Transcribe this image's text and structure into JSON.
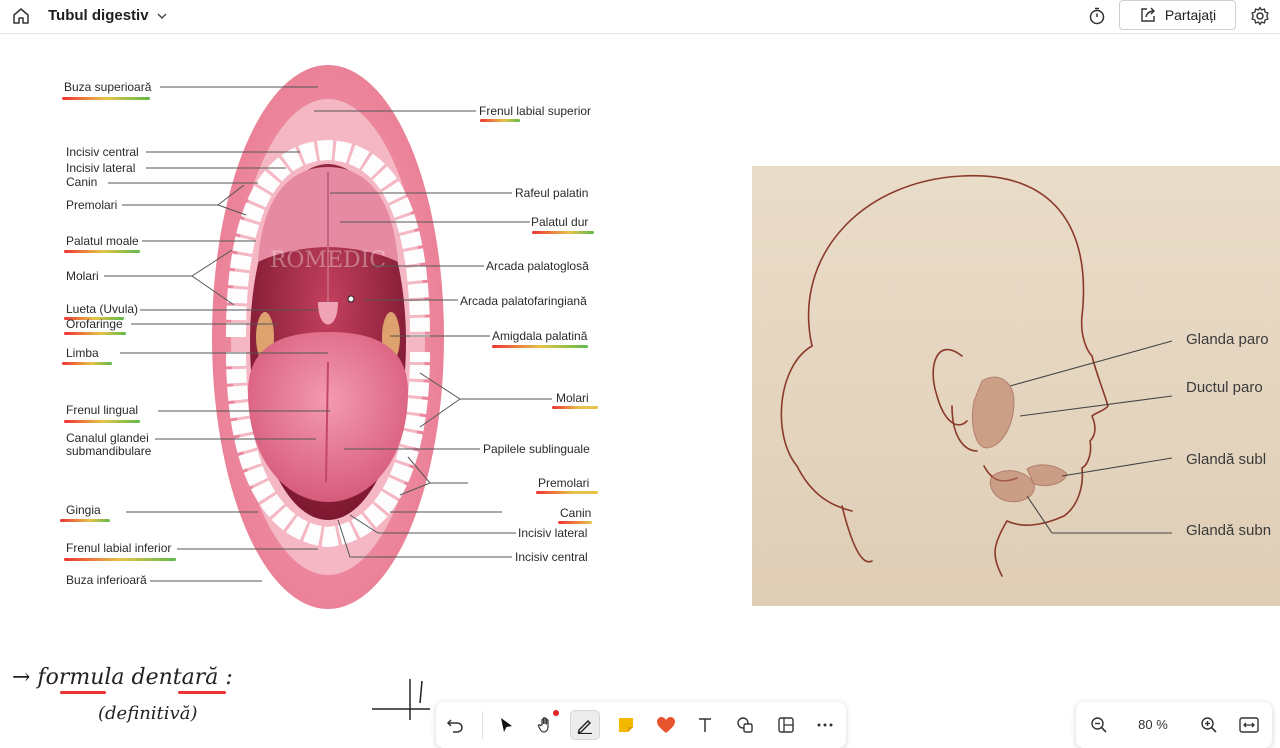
{
  "header": {
    "title": "Tubul digestiv",
    "share_label": "Partajați"
  },
  "mouth_labels_left": [
    "Buza superioară",
    "Incisiv central",
    "Incisiv lateral",
    "Canin",
    "Premolari",
    "Palatul moale",
    "Molari",
    "Lueta (Uvula)",
    "Orofaringe",
    "Limba",
    "Frenul lingual",
    "Canalul glandei",
    "submandibulare",
    "Gingia",
    "Frenul labial inferior",
    "Buza inferioară"
  ],
  "mouth_labels_right": [
    "Frenul labial superior",
    "Rafeul palatin",
    "Palatul dur",
    "Arcada palatoglosă",
    "Arcada palatofaringiană",
    "Amigdala palatină",
    "Molari",
    "Papilele sublinguale",
    "Premolari",
    "Canin",
    "Incisiv lateral",
    "Incisiv central"
  ],
  "watermark": "ROMEDIC",
  "face_labels": [
    "Glanda paro",
    "Ductul paro",
    "Glandă subl",
    "Glandă subn"
  ],
  "handwriting": {
    "line1": "→ formula  dentară :",
    "line2": "(definitivă)"
  },
  "toolbar": {
    "tools": [
      "undo-icon",
      "select-icon",
      "pan-icon",
      "pen-icon",
      "sticky-note-icon",
      "reaction-icon",
      "text-icon",
      "shapes-icon",
      "templates-icon",
      "more-icon"
    ],
    "accent": "#e02424",
    "sticky_color": "#f5b800"
  },
  "zoom": {
    "value": "80 %"
  }
}
